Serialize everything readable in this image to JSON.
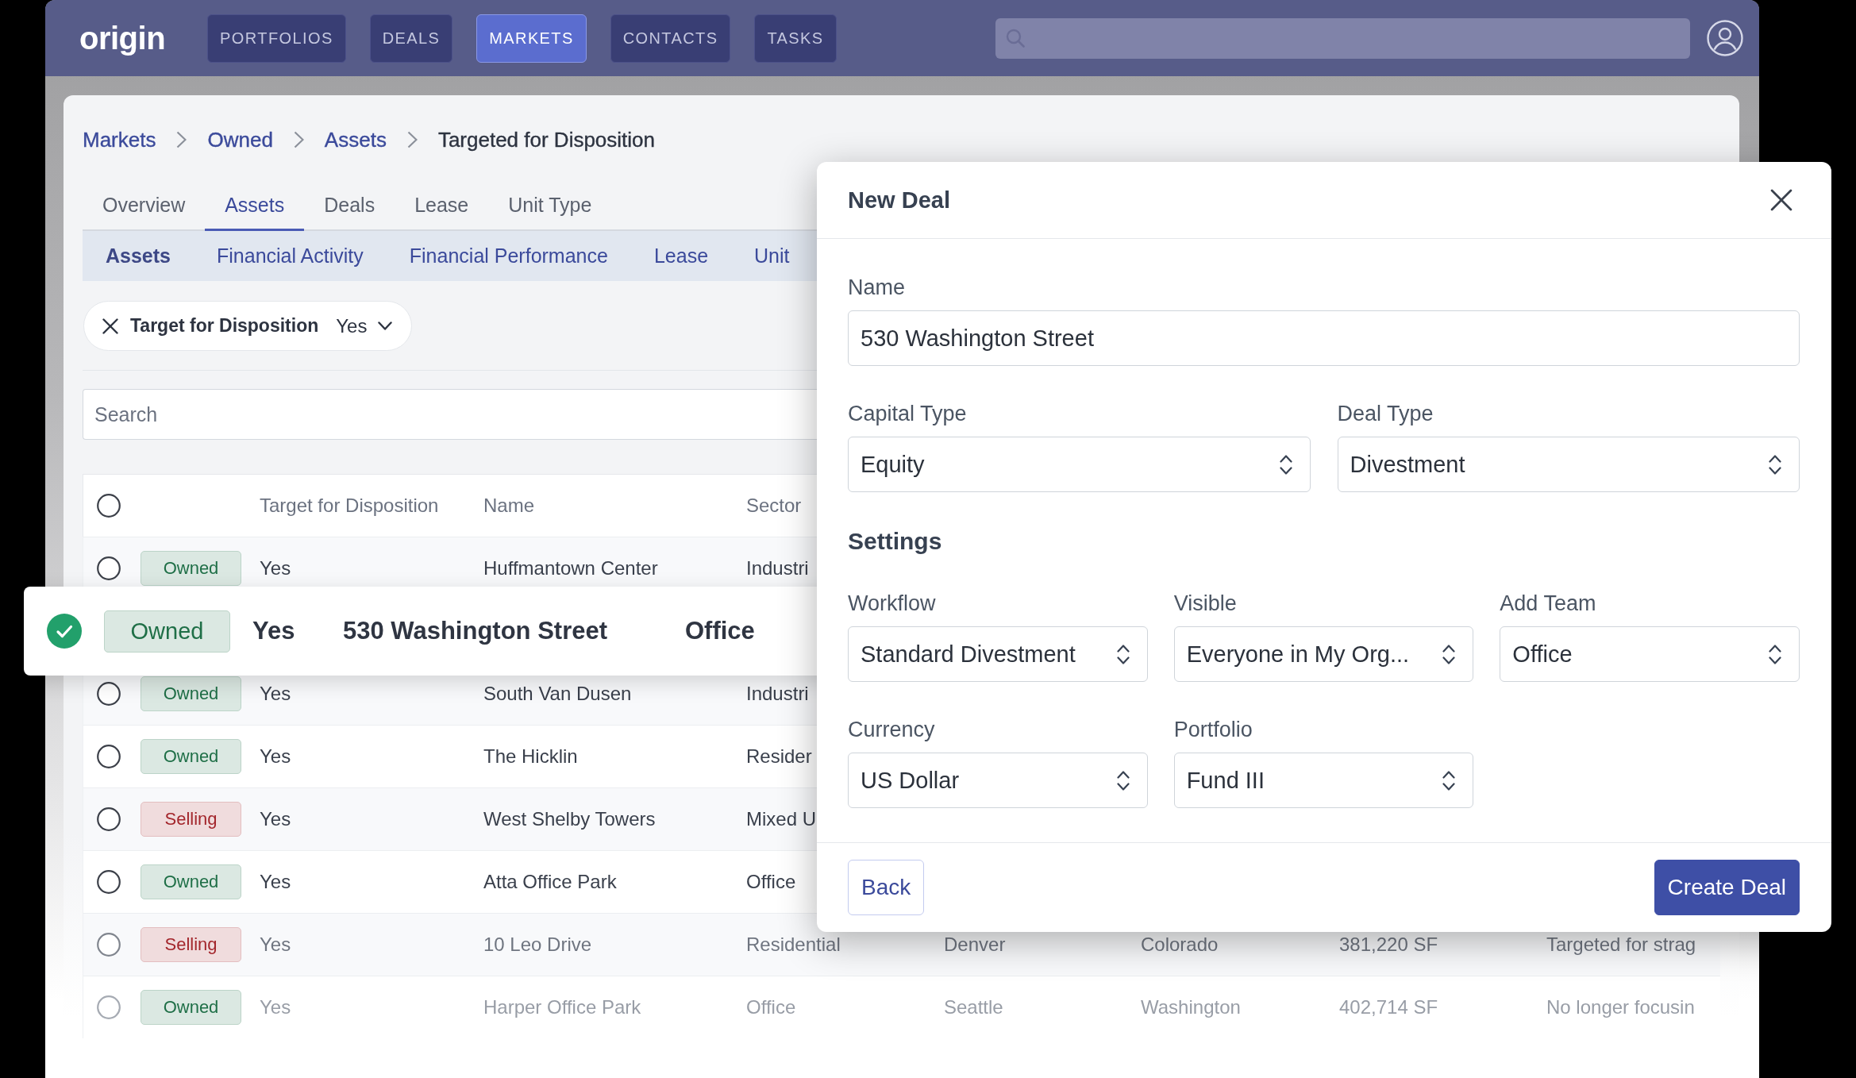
{
  "nav": {
    "logo": "origin",
    "items": [
      {
        "label": "PORTFOLIOS",
        "selected": false
      },
      {
        "label": "DEALS",
        "selected": false
      },
      {
        "label": "MARKETS",
        "selected": true
      },
      {
        "label": "CONTACTS",
        "selected": false
      },
      {
        "label": "TASKS",
        "selected": false
      }
    ]
  },
  "breadcrumb": [
    {
      "label": "Markets",
      "kind": "link"
    },
    {
      "label": "Owned",
      "kind": "link"
    },
    {
      "label": "Assets",
      "kind": "link"
    },
    {
      "label": "Targeted for Disposition",
      "kind": "current"
    }
  ],
  "tabs": [
    {
      "label": "Overview",
      "selected": false
    },
    {
      "label": "Assets",
      "selected": true
    },
    {
      "label": "Deals",
      "selected": false
    },
    {
      "label": "Lease",
      "selected": false
    },
    {
      "label": "Unit Type",
      "selected": false
    }
  ],
  "subtabs": [
    {
      "label": "Assets",
      "selected": true
    },
    {
      "label": "Financial Activity",
      "selected": false
    },
    {
      "label": "Financial Performance",
      "selected": false
    },
    {
      "label": "Lease",
      "selected": false
    },
    {
      "label": "Unit",
      "selected": false
    }
  ],
  "filter": {
    "label": "Target for Disposition",
    "value": "Yes"
  },
  "search": {
    "placeholder": "Search"
  },
  "table": {
    "all_selected": false,
    "columns": [
      "Target for Disposition",
      "Name",
      "Sector"
    ],
    "rows": [
      {
        "kind": "row",
        "selected": false,
        "status": {
          "label": "Owned",
          "color": "#1f6f47"
        },
        "cells": [
          "Yes",
          "Huffmantown Center",
          "Industri"
        ]
      },
      {
        "kind": "card",
        "selected": true,
        "status": {
          "label": "Owned",
          "color": "#1f6f47"
        },
        "cells": [
          "Yes",
          "530 Washington Street",
          "Office"
        ]
      },
      {
        "kind": "row",
        "selected": false,
        "status": {
          "label": "Owned",
          "color": "#1f6f47"
        },
        "cells": [
          "Yes",
          "South Van Dusen",
          "Industri"
        ]
      },
      {
        "kind": "row",
        "selected": false,
        "status": {
          "label": "Owned",
          "color": "#1f6f47"
        },
        "cells": [
          "Yes",
          "The Hicklin",
          "Resider"
        ]
      },
      {
        "kind": "row",
        "selected": false,
        "status": {
          "label": "Selling",
          "color": "#a3262c"
        },
        "cells": [
          "Yes",
          "West Shelby Towers",
          "Mixed U"
        ]
      },
      {
        "kind": "row",
        "selected": false,
        "status": {
          "label": "Owned",
          "color": "#1f6f47"
        },
        "cells": [
          "Yes",
          "Atta Office Park",
          "Office"
        ]
      },
      {
        "kind": "row",
        "selected": false,
        "status": {
          "label": "Selling",
          "color": "#a3262c"
        },
        "cells": [
          "Yes",
          "10 Leo Drive",
          "Residential",
          "Denver",
          "Colorado",
          "381,220 SF",
          "Targeted for strag"
        ]
      },
      {
        "kind": "row",
        "selected": false,
        "status": {
          "label": "Owned",
          "color": "#1f6f47"
        },
        "cells": [
          "Yes",
          "Harper Office Park",
          "Office",
          "Seattle",
          "Washington",
          "402,714 SF",
          "No longer focusin"
        ]
      }
    ]
  },
  "modal": {
    "title": "New Deal",
    "name_field": {
      "label": "Name",
      "value": "530 Washington Street"
    },
    "deal_fields": [
      {
        "label": "Capital Type",
        "value": "Equity"
      },
      {
        "label": "Deal Type",
        "value": "Divestment"
      }
    ],
    "settings": {
      "heading": "Settings",
      "rows": [
        {
          "fields": [
            {
              "label": "Workflow",
              "value": "Standard Divestment"
            },
            {
              "label": "Visible",
              "value": "Everyone in My Org..."
            },
            {
              "label": "Add Team",
              "value": "Office"
            }
          ]
        },
        {
          "fields": [
            {
              "label": "Currency",
              "value": "US Dollar"
            },
            {
              "label": "Portfolio",
              "value": "Fund III"
            }
          ]
        }
      ]
    },
    "buttons": [
      {
        "label": "Back",
        "kind": "secondary"
      },
      {
        "label": "Create Deal",
        "kind": "primary"
      }
    ]
  }
}
